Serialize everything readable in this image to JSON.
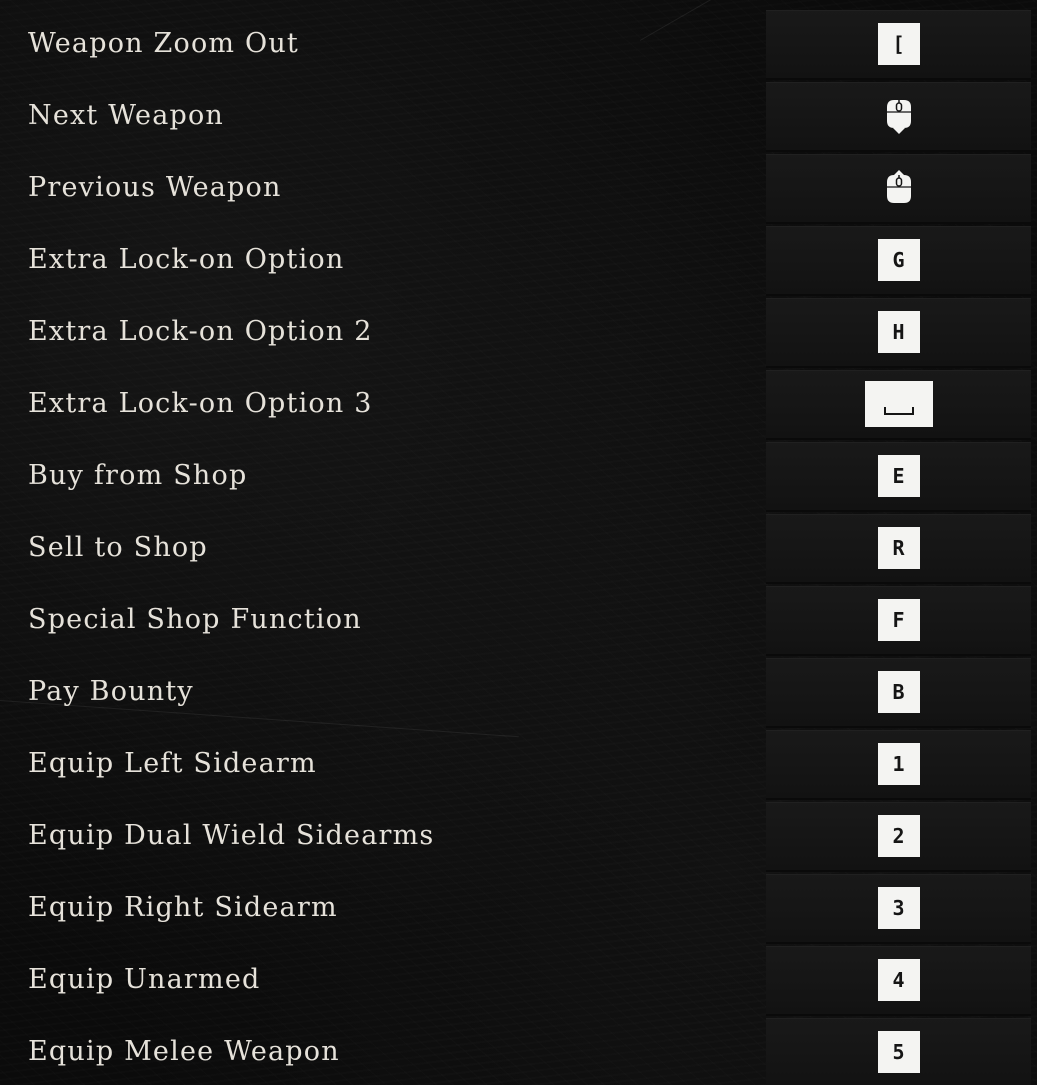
{
  "bindings": [
    {
      "action": "Weapon Zoom Out",
      "key": "[",
      "key_type": "key"
    },
    {
      "action": "Next Weapon",
      "key": "",
      "key_type": "mouse",
      "icon": "mouse-wheel-down-icon"
    },
    {
      "action": "Previous Weapon",
      "key": "",
      "key_type": "mouse",
      "icon": "mouse-wheel-up-icon"
    },
    {
      "action": "Extra Lock-on Option",
      "key": "G",
      "key_type": "key"
    },
    {
      "action": "Extra Lock-on Option 2",
      "key": "H",
      "key_type": "key"
    },
    {
      "action": "Extra Lock-on Option 3",
      "key": "",
      "key_type": "space",
      "icon": "spacebar-icon"
    },
    {
      "action": "Buy from Shop",
      "key": "E",
      "key_type": "key"
    },
    {
      "action": "Sell to Shop",
      "key": "R",
      "key_type": "key"
    },
    {
      "action": "Special Shop Function",
      "key": "F",
      "key_type": "key"
    },
    {
      "action": "Pay Bounty",
      "key": "B",
      "key_type": "key"
    },
    {
      "action": "Equip Left Sidearm",
      "key": "1",
      "key_type": "key"
    },
    {
      "action": "Equip Dual Wield Sidearms",
      "key": "2",
      "key_type": "key"
    },
    {
      "action": "Equip Right Sidearm",
      "key": "3",
      "key_type": "key"
    },
    {
      "action": "Equip Unarmed",
      "key": "4",
      "key_type": "key"
    },
    {
      "action": "Equip Melee Weapon",
      "key": "5",
      "key_type": "key"
    }
  ],
  "colors": {
    "label_text": "#e6e2da",
    "cell_bg": "#161616",
    "key_bg": "#f4f4f2",
    "key_text": "#151515"
  }
}
